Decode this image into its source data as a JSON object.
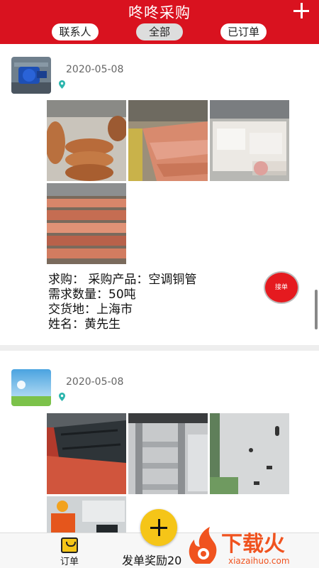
{
  "header": {
    "title": "咚咚采购"
  },
  "filters": {
    "contacts": "联系人",
    "all": "全部",
    "ordered": "已订单"
  },
  "posts": [
    {
      "date": "2020-05-08",
      "lines": [
        "求购： 采购产品：空调铜管",
        "需求数量：50吨",
        "交货地：上海市",
        "姓名：黄先生"
      ],
      "button_label": "接单"
    },
    {
      "date": "2020-05-08"
    }
  ],
  "bottom": {
    "orders_label": "订单",
    "reward_text": "发单奖励20"
  },
  "watermark": {
    "brand": "下载火",
    "url": "xiazaihuo.com"
  },
  "colors": {
    "brand_red": "#d9121f",
    "accent_yellow": "#f5c518",
    "watermark_orange": "#f0531f"
  }
}
